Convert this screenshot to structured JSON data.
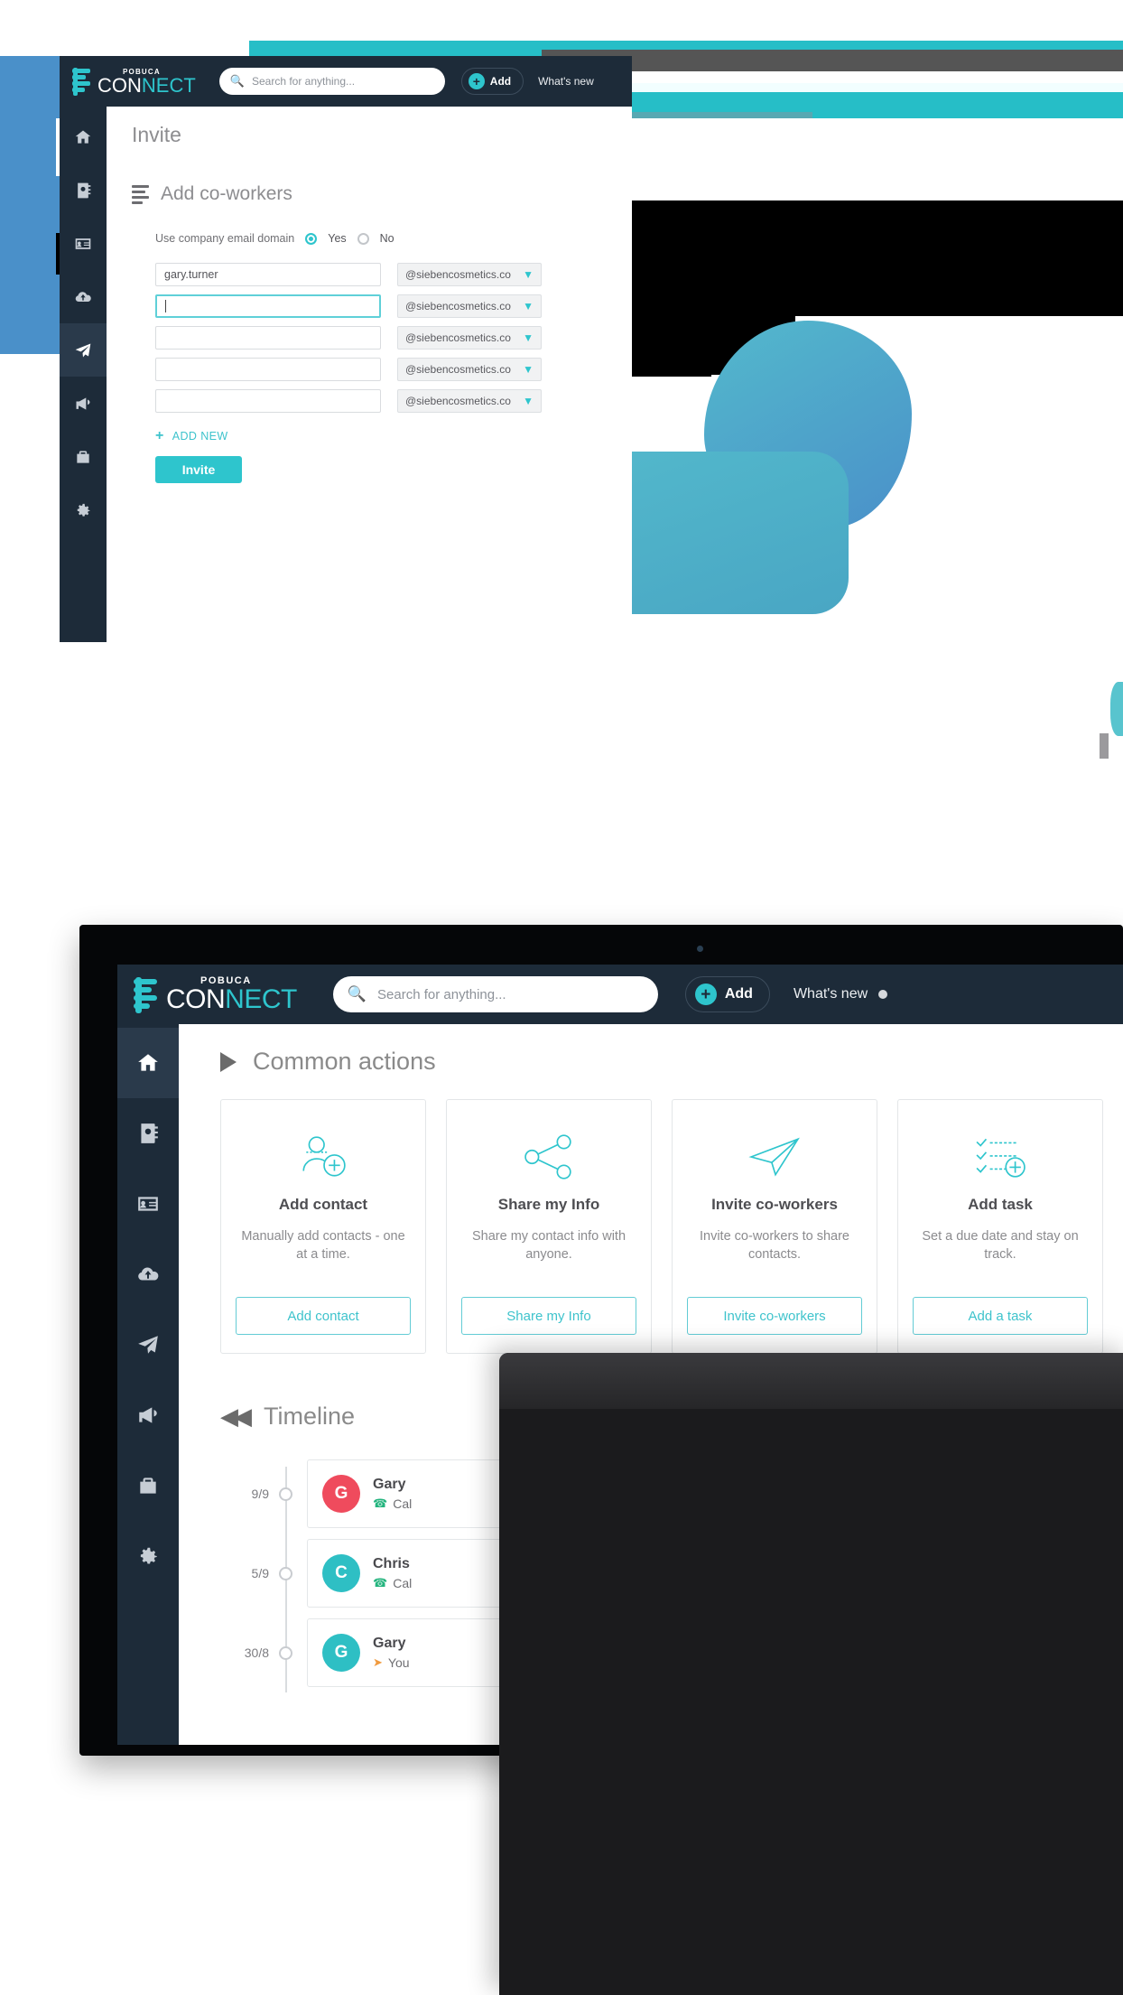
{
  "hero": {
    "note": "Extremely zoomed-in marketing page header; text is cropped to solid blocks",
    "colors": {
      "blue": "#4a90c9",
      "teal": "#26bec7",
      "gray": "#555555",
      "black": "#000000"
    }
  },
  "app": {
    "brand": {
      "sub": "POBUCA",
      "main_light": "CON",
      "main_accent": "NECT",
      "full": "CONNECT"
    },
    "search": {
      "placeholder": "Search for anything...",
      "icon": "search-icon"
    },
    "add_button": {
      "label": "Add",
      "icon": "plus-circle-icon"
    },
    "whats_new": {
      "label": "What's new",
      "badge": "●"
    },
    "sidebar": [
      {
        "name": "home",
        "icon": "home-icon",
        "active": true
      },
      {
        "name": "contacts",
        "icon": "address-book-icon",
        "active": false
      },
      {
        "name": "my-card",
        "icon": "contact-card-icon",
        "active": false
      },
      {
        "name": "import",
        "icon": "cloud-upload-icon",
        "active": false
      },
      {
        "name": "invite",
        "icon": "paper-plane-icon",
        "active": false
      },
      {
        "name": "campaigns",
        "icon": "megaphone-icon",
        "active": false
      },
      {
        "name": "organizations",
        "icon": "briefcase-icon",
        "active": false
      },
      {
        "name": "settings",
        "icon": "gear-icon",
        "active": false
      }
    ],
    "common_actions": {
      "title": "Common actions",
      "toggle_icon": "play-triangle-icon",
      "cards": [
        {
          "icon": "add-contact-icon",
          "title": "Add contact",
          "desc": "Manually add contacts - one at a time.",
          "button": "Add contact"
        },
        {
          "icon": "share-nodes-icon",
          "title": "Share my Info",
          "desc": "Share my contact info with anyone.",
          "button": "Share my Info"
        },
        {
          "icon": "paper-plane-icon",
          "title": "Invite co-workers",
          "desc": "Invite co-workers to share contacts.",
          "button": "Invite co-workers"
        },
        {
          "icon": "checklist-add-icon",
          "title": "Add task",
          "desc": "Set a due date and stay on track.",
          "button": "Add a task"
        }
      ]
    },
    "timeline": {
      "title": "Timeline",
      "toggle_icon": "rewind-icon",
      "items": [
        {
          "date": "9/9",
          "initial": "G",
          "color": "#ef4b5d",
          "name": "Gary",
          "activity_icon": "phone-icon",
          "activity": "Cal"
        },
        {
          "date": "5/9",
          "initial": "C",
          "color": "#2ebfc4",
          "name": "Chris",
          "activity_icon": "phone-icon",
          "activity": "Cal"
        },
        {
          "date": "30/8",
          "initial": "G",
          "color": "#2ebfc4",
          "name": "Gary",
          "activity_icon": "share-icon",
          "activity": "You"
        }
      ]
    }
  },
  "tablet": {
    "page_title": "Invite",
    "section_title": "Add co-workers",
    "section_icon": "list-icon",
    "domain_question": "Use company email domain",
    "radio_yes": "Yes",
    "radio_no": "No",
    "radio_selected": "Yes",
    "domain_option": "@siebencosmetics.co",
    "rows": [
      {
        "value": "gary.turner",
        "focused": false,
        "domain": "@siebencosmetics.co"
      },
      {
        "value": "",
        "focused": true,
        "domain": "@siebencosmetics.co"
      },
      {
        "value": "",
        "focused": false,
        "domain": "@siebencosmetics.co"
      },
      {
        "value": "",
        "focused": false,
        "domain": "@siebencosmetics.co"
      },
      {
        "value": "",
        "focused": false,
        "domain": "@siebencosmetics.co"
      }
    ],
    "add_new": "ADD NEW",
    "invite_button": "Invite"
  }
}
